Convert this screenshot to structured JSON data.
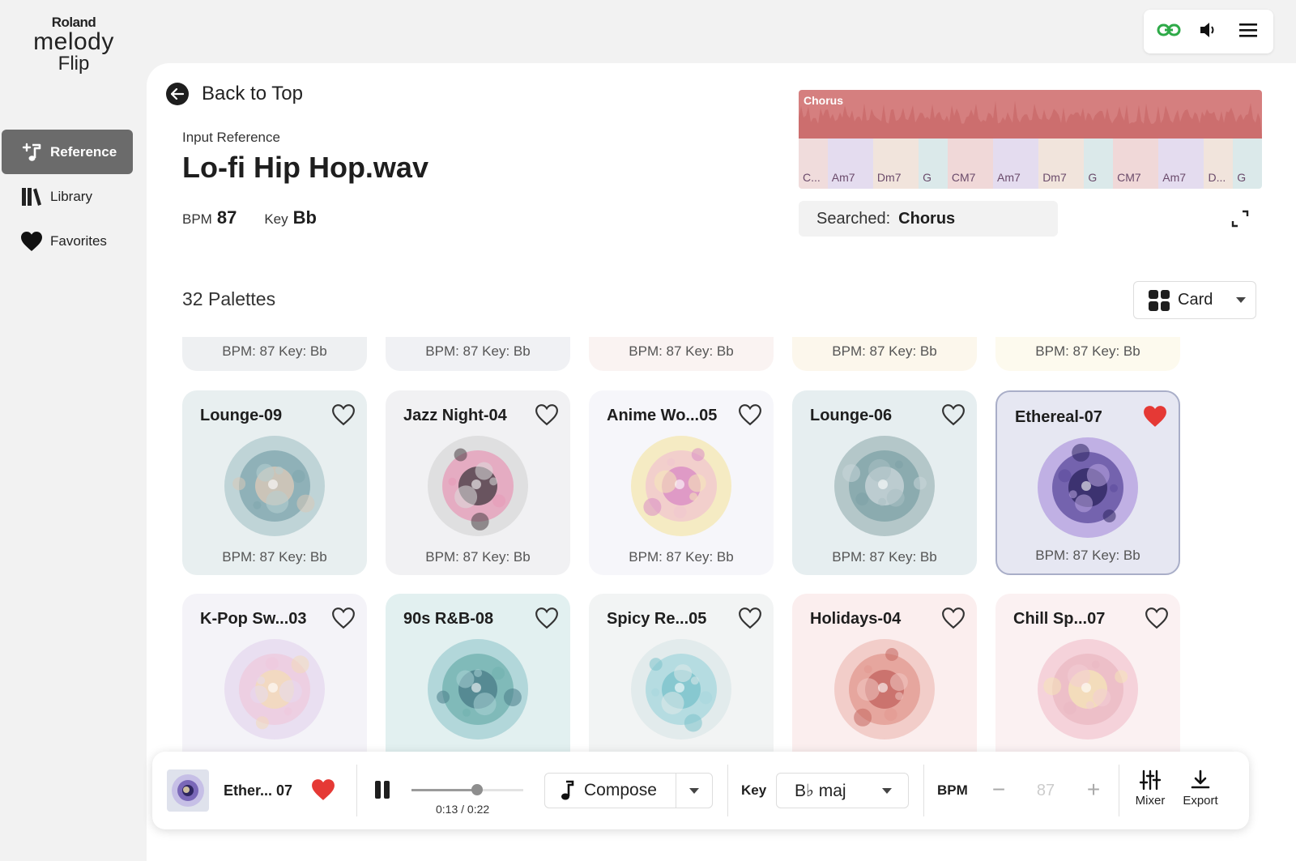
{
  "brand": {
    "maker": "Roland",
    "product": "melody",
    "sub": "Flip"
  },
  "sidebar": {
    "items": [
      {
        "label": "Reference",
        "icon": "music-note-plus-icon",
        "active": true
      },
      {
        "label": "Library",
        "icon": "library-books-icon",
        "active": false
      },
      {
        "label": "Favorites",
        "icon": "heart-icon",
        "active": false
      }
    ]
  },
  "topbar": {
    "icons": [
      "link-icon",
      "volume-icon",
      "menu-icon"
    ]
  },
  "header": {
    "back_label": "Back to Top",
    "input_reference_label": "Input Reference",
    "file_name": "Lo-fi Hip Hop.wav",
    "bpm_label": "BPM",
    "bpm_value": "87",
    "key_label": "Key",
    "key_value": "Bb"
  },
  "waveform": {
    "section_label": "Chorus",
    "chords": [
      {
        "label": "C...",
        "color": "#f0dcdc"
      },
      {
        "label": "Am7",
        "color": "#e4dcef"
      },
      {
        "label": "Dm7",
        "color": "#f1e4dc"
      },
      {
        "label": "G",
        "color": "#dbe9ea"
      },
      {
        "label": "CM7",
        "color": "#f0d8d8"
      },
      {
        "label": "Am7",
        "color": "#e4dcef"
      },
      {
        "label": "Dm7",
        "color": "#f1e4dc"
      },
      {
        "label": "G",
        "color": "#dbe9ea"
      },
      {
        "label": "CM7",
        "color": "#f0d8d8"
      },
      {
        "label": "Am7",
        "color": "#e4dcef"
      },
      {
        "label": "D...",
        "color": "#f1e4dc"
      },
      {
        "label": "G",
        "color": "#dbe9ea"
      }
    ]
  },
  "searched": {
    "label": "Searched:",
    "value": "Chorus"
  },
  "palettes": {
    "count_label": "32 Palettes",
    "view_label": "Card",
    "cards": [
      {
        "title": "",
        "meta": "BPM: 87  Key: Bb",
        "bg": "#eef0f2",
        "favorite": false,
        "orb": [
          "#cfd8dc",
          "#b0bec5"
        ],
        "partial": true
      },
      {
        "title": "",
        "meta": "BPM: 87  Key: Bb",
        "bg": "#f0f1f4",
        "favorite": false,
        "orb": [
          "#d6d6e3",
          "#bcbcd0"
        ],
        "partial": true
      },
      {
        "title": "",
        "meta": "BPM: 87  Key: Bb",
        "bg": "#faf3f2",
        "favorite": false,
        "orb": [
          "#f3d6d4",
          "#e8bfbd"
        ],
        "partial": true
      },
      {
        "title": "",
        "meta": "BPM: 87  Key: Bb",
        "bg": "#fcf7ec",
        "favorite": false,
        "orb": [
          "#f5e6c5",
          "#eed6a6"
        ],
        "partial": true
      },
      {
        "title": "",
        "meta": "BPM: 87  Key: Bb",
        "bg": "#fdfaee",
        "favorite": false,
        "orb": [
          "#f5eac8",
          "#ecdca8"
        ],
        "partial": true
      },
      {
        "title": "Lounge-09",
        "meta": "BPM: 87  Key: Bb",
        "bg": "#e8eff0",
        "favorite": false,
        "orb": [
          "#b7cfd2",
          "#7fa6ad",
          "#d9c9b8"
        ]
      },
      {
        "title": "Jazz Night-04",
        "meta": "BPM: 87  Key: Bb",
        "bg": "#f1f1f3",
        "favorite": false,
        "orb": [
          "#dcdcdc",
          "#e79bb8",
          "#4a3f46"
        ]
      },
      {
        "title": "Anime Wo...05",
        "meta": "BPM: 87  Key: Bb",
        "bg": "#f6f6fa",
        "favorite": false,
        "orb": [
          "#f5e9b8",
          "#f0c6cf",
          "#d98cc4"
        ]
      },
      {
        "title": "Lounge-06",
        "meta": "BPM: 87  Key: Bb",
        "bg": "#e6eef0",
        "favorite": false,
        "orb": [
          "#aac0c2",
          "#7ea1a6",
          "#c8d5d8"
        ]
      },
      {
        "title": "Ethereal-07",
        "meta": "BPM: 87  Key: Bb",
        "bg": "#e6e7f2",
        "favorite": true,
        "selected": true,
        "orb": [
          "#b9a6e2",
          "#5b4a9c",
          "#2e2660"
        ]
      },
      {
        "title": "K-Pop Sw...03",
        "meta": "",
        "bg": "#f4f3f8",
        "favorite": false,
        "orb": [
          "#e6daf0",
          "#eec9dc",
          "#f3dbb9"
        ]
      },
      {
        "title": "90s R&B-08",
        "meta": "",
        "bg": "#e2f0f0",
        "favorite": false,
        "orb": [
          "#a9d2d6",
          "#6fb0ae",
          "#4b7e8a"
        ]
      },
      {
        "title": "Spicy Re...05",
        "meta": "",
        "bg": "#f2f4f4",
        "favorite": false,
        "orb": [
          "#dfe9ea",
          "#a6d7de",
          "#7cc3cc"
        ]
      },
      {
        "title": "Holidays-04",
        "meta": "",
        "bg": "#fbeeee",
        "favorite": false,
        "orb": [
          "#f0c7c2",
          "#e1988f",
          "#c46761"
        ]
      },
      {
        "title": "Chill Sp...07",
        "meta": "",
        "bg": "#fbf1f2",
        "favorite": false,
        "orb": [
          "#f3cdd6",
          "#eab8c2",
          "#f4e4b8"
        ]
      }
    ]
  },
  "player": {
    "track_name": "Ether... 07",
    "favorite": true,
    "progress": 0.59,
    "time": "0:13 / 0:22",
    "compose_label": "Compose",
    "key_label": "Key",
    "key_value": "B♭ maj",
    "bpm_label": "BPM",
    "bpm_value": "87",
    "mixer_label": "Mixer",
    "export_label": "Export"
  },
  "colors": {
    "accent_heart": "#e53935",
    "text": "#1e1e1e",
    "link_green": "#2eaa48"
  }
}
